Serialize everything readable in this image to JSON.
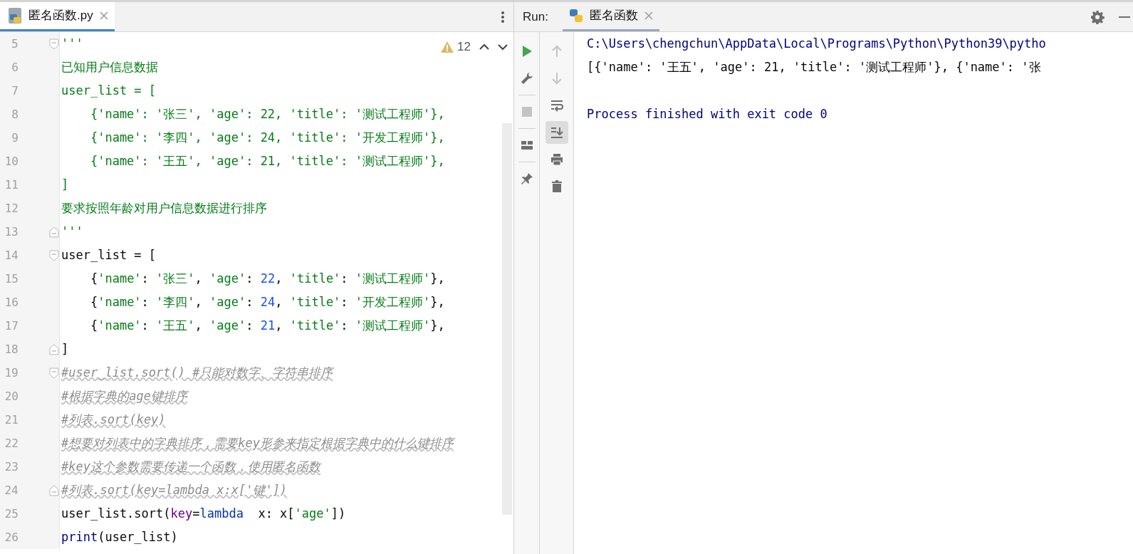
{
  "editor": {
    "tab": {
      "title": "匿名函数.py",
      "selected": true
    },
    "inspection": {
      "count": "12"
    },
    "lines": [
      {
        "number": "5",
        "fold_start": true,
        "fold_end": false,
        "tokens": [
          {
            "kind": "doc",
            "text": "'''"
          }
        ]
      },
      {
        "number": "6",
        "fold_start": false,
        "fold_end": false,
        "tokens": [
          {
            "kind": "doc",
            "text": "已知用户信息数据"
          }
        ]
      },
      {
        "number": "7",
        "fold_start": false,
        "fold_end": false,
        "tokens": [
          {
            "kind": "doc",
            "text": "user_list = ["
          }
        ]
      },
      {
        "number": "8",
        "fold_start": false,
        "fold_end": false,
        "tokens": [
          {
            "kind": "doc",
            "text": "    {'name': '张三', 'age': 22, 'title': '测试工程师'},"
          }
        ]
      },
      {
        "number": "9",
        "fold_start": false,
        "fold_end": false,
        "tokens": [
          {
            "kind": "doc",
            "text": "    {'name': '李四', 'age': 24, 'title': '开发工程师'},"
          }
        ]
      },
      {
        "number": "10",
        "fold_start": false,
        "fold_end": false,
        "tokens": [
          {
            "kind": "doc",
            "text": "    {'name': '王五', 'age': 21, 'title': '测试工程师'},"
          }
        ]
      },
      {
        "number": "11",
        "fold_start": false,
        "fold_end": false,
        "tokens": [
          {
            "kind": "doc",
            "text": "]"
          }
        ]
      },
      {
        "number": "12",
        "fold_start": false,
        "fold_end": false,
        "tokens": [
          {
            "kind": "doc",
            "text": "要求按照年龄对用户信息数据进行排序"
          }
        ]
      },
      {
        "number": "13",
        "fold_start": false,
        "fold_end": true,
        "tokens": [
          {
            "kind": "doc",
            "text": "'''"
          }
        ]
      },
      {
        "number": "14",
        "fold_start": true,
        "fold_end": false,
        "tokens": [
          {
            "kind": "plain",
            "text": "user_list = ["
          }
        ]
      },
      {
        "number": "15",
        "fold_start": false,
        "fold_end": false,
        "tokens": [
          {
            "kind": "plain",
            "text": "    {"
          },
          {
            "kind": "str",
            "text": "'name'"
          },
          {
            "kind": "plain",
            "text": ": "
          },
          {
            "kind": "str",
            "text": "'张三'"
          },
          {
            "kind": "plain",
            "text": ", "
          },
          {
            "kind": "str",
            "text": "'age'"
          },
          {
            "kind": "plain",
            "text": ": "
          },
          {
            "kind": "num",
            "text": "22"
          },
          {
            "kind": "plain",
            "text": ", "
          },
          {
            "kind": "str",
            "text": "'title'"
          },
          {
            "kind": "plain",
            "text": ": "
          },
          {
            "kind": "str",
            "text": "'测试工程师'"
          },
          {
            "kind": "plain",
            "text": "},"
          }
        ]
      },
      {
        "number": "16",
        "fold_start": false,
        "fold_end": false,
        "tokens": [
          {
            "kind": "plain",
            "text": "    {"
          },
          {
            "kind": "str",
            "text": "'name'"
          },
          {
            "kind": "plain",
            "text": ": "
          },
          {
            "kind": "str",
            "text": "'李四'"
          },
          {
            "kind": "plain",
            "text": ", "
          },
          {
            "kind": "str",
            "text": "'age'"
          },
          {
            "kind": "plain",
            "text": ": "
          },
          {
            "kind": "num",
            "text": "24"
          },
          {
            "kind": "plain",
            "text": ", "
          },
          {
            "kind": "str",
            "text": "'title'"
          },
          {
            "kind": "plain",
            "text": ": "
          },
          {
            "kind": "str",
            "text": "'开发工程师'"
          },
          {
            "kind": "plain",
            "text": "},"
          }
        ]
      },
      {
        "number": "17",
        "fold_start": false,
        "fold_end": false,
        "tokens": [
          {
            "kind": "plain",
            "text": "    {"
          },
          {
            "kind": "str",
            "text": "'name'"
          },
          {
            "kind": "plain",
            "text": ": "
          },
          {
            "kind": "str",
            "text": "'王五'"
          },
          {
            "kind": "plain",
            "text": ", "
          },
          {
            "kind": "str",
            "text": "'age'"
          },
          {
            "kind": "plain",
            "text": ": "
          },
          {
            "kind": "num",
            "text": "21"
          },
          {
            "kind": "plain",
            "text": ", "
          },
          {
            "kind": "str",
            "text": "'title'"
          },
          {
            "kind": "plain",
            "text": ": "
          },
          {
            "kind": "str",
            "text": "'测试工程师'"
          },
          {
            "kind": "plain",
            "text": "},"
          }
        ]
      },
      {
        "number": "18",
        "fold_start": false,
        "fold_end": true,
        "tokens": [
          {
            "kind": "plain",
            "text": "]"
          }
        ]
      },
      {
        "number": "19",
        "fold_start": true,
        "fold_end": false,
        "tokens": [
          {
            "kind": "comment",
            "text": "#user_list.sort() #只能对数字、字符串排序"
          }
        ]
      },
      {
        "number": "20",
        "fold_start": false,
        "fold_end": false,
        "tokens": [
          {
            "kind": "comment",
            "text": "#根据字典的age键排序"
          }
        ]
      },
      {
        "number": "21",
        "fold_start": false,
        "fold_end": false,
        "tokens": [
          {
            "kind": "comment",
            "text": "#列表.sort(key)"
          }
        ]
      },
      {
        "number": "22",
        "fold_start": false,
        "fold_end": false,
        "tokens": [
          {
            "kind": "comment",
            "text": "#想要对列表中的字典排序，需要key形参来指定根据字典中的什么键排序"
          }
        ]
      },
      {
        "number": "23",
        "fold_start": false,
        "fold_end": false,
        "tokens": [
          {
            "kind": "comment",
            "text": "#key这个参数需要传递一个函数，使用匿名函数"
          }
        ]
      },
      {
        "number": "24",
        "fold_start": false,
        "fold_end": true,
        "tokens": [
          {
            "kind": "comment",
            "text": "#列表.sort(key=lambda x:x['键'])"
          }
        ]
      },
      {
        "number": "25",
        "fold_start": false,
        "fold_end": false,
        "tokens": [
          {
            "kind": "plain",
            "text": "user_list.sort("
          },
          {
            "kind": "param",
            "text": "key"
          },
          {
            "kind": "plain",
            "text": "="
          },
          {
            "kind": "keyword",
            "text": "lambda"
          },
          {
            "kind": "plain",
            "text": "  x: x["
          },
          {
            "kind": "str",
            "text": "'age'"
          },
          {
            "kind": "plain",
            "text": "])"
          }
        ]
      },
      {
        "number": "26",
        "fold_start": false,
        "fold_end": false,
        "tokens": [
          {
            "kind": "builtin",
            "text": "print"
          },
          {
            "kind": "plain",
            "text": "(user_list)"
          }
        ]
      }
    ]
  },
  "run_panel": {
    "label": "Run:",
    "tab": {
      "title": "匿名函数",
      "selected": true
    },
    "toolbar_left": [
      {
        "kind": "run",
        "disabled": false,
        "on": false
      },
      {
        "kind": "wrench",
        "disabled": false,
        "on": false
      },
      {
        "kind": "stop",
        "disabled": true,
        "on": false
      },
      {
        "kind": "layout",
        "disabled": false,
        "on": false
      },
      {
        "kind": "pin",
        "disabled": false,
        "on": false
      }
    ],
    "toolbar_right": [
      {
        "kind": "up",
        "disabled": true,
        "on": false
      },
      {
        "kind": "down",
        "disabled": true,
        "on": false
      },
      {
        "kind": "wrap",
        "disabled": false,
        "on": false
      },
      {
        "kind": "scroll-end",
        "disabled": false,
        "on": true
      },
      {
        "kind": "print",
        "disabled": false,
        "on": false
      },
      {
        "kind": "trash",
        "disabled": false,
        "on": false
      }
    ],
    "output": [
      {
        "kind": "command",
        "text": "C:\\Users\\chengchun\\AppData\\Local\\Programs\\Python\\Python39\\pytho"
      },
      {
        "kind": "stdout",
        "text": "[{'name': '王五', 'age': 21, 'title': '测试工程师'}, {'name': '张"
      },
      {
        "kind": "exit",
        "text": "Process finished with exit code 0"
      }
    ]
  }
}
